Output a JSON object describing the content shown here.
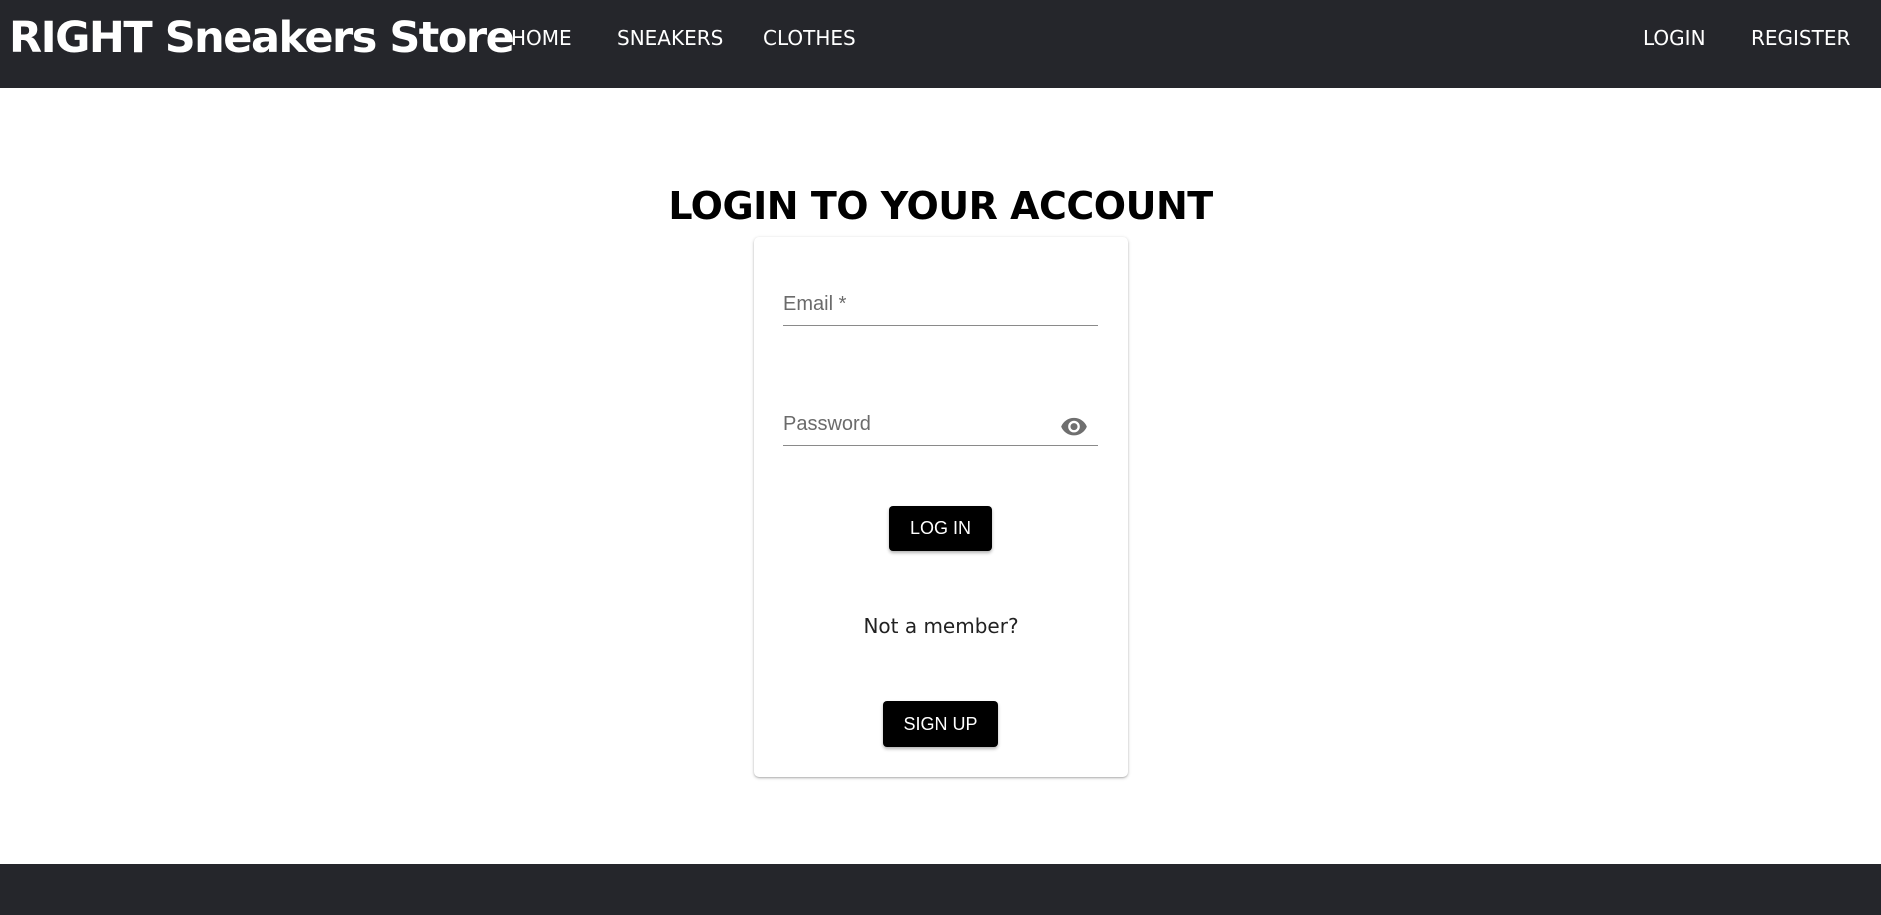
{
  "header": {
    "brand": "RIGHT Sneakers Store",
    "nav": {
      "home": "HOME",
      "sneakers": "SNEAKERS",
      "clothes": "CLOTHES",
      "login": "LOGIN",
      "register": "REGISTER"
    },
    "background_color": "#25262b"
  },
  "main": {
    "title": "LOGIN TO YOUR ACCOUNT",
    "form": {
      "email": {
        "placeholder": "Email *",
        "value": ""
      },
      "password": {
        "placeholder": "Password",
        "value": "",
        "toggle_icon": "eye-icon"
      },
      "login_button": "LOG IN",
      "not_member_text": "Not a member?",
      "signup_button": "SIGN UP"
    }
  },
  "colors": {
    "button_bg": "#000000",
    "button_text": "#ffffff",
    "footer_bg": "#25262b"
  }
}
